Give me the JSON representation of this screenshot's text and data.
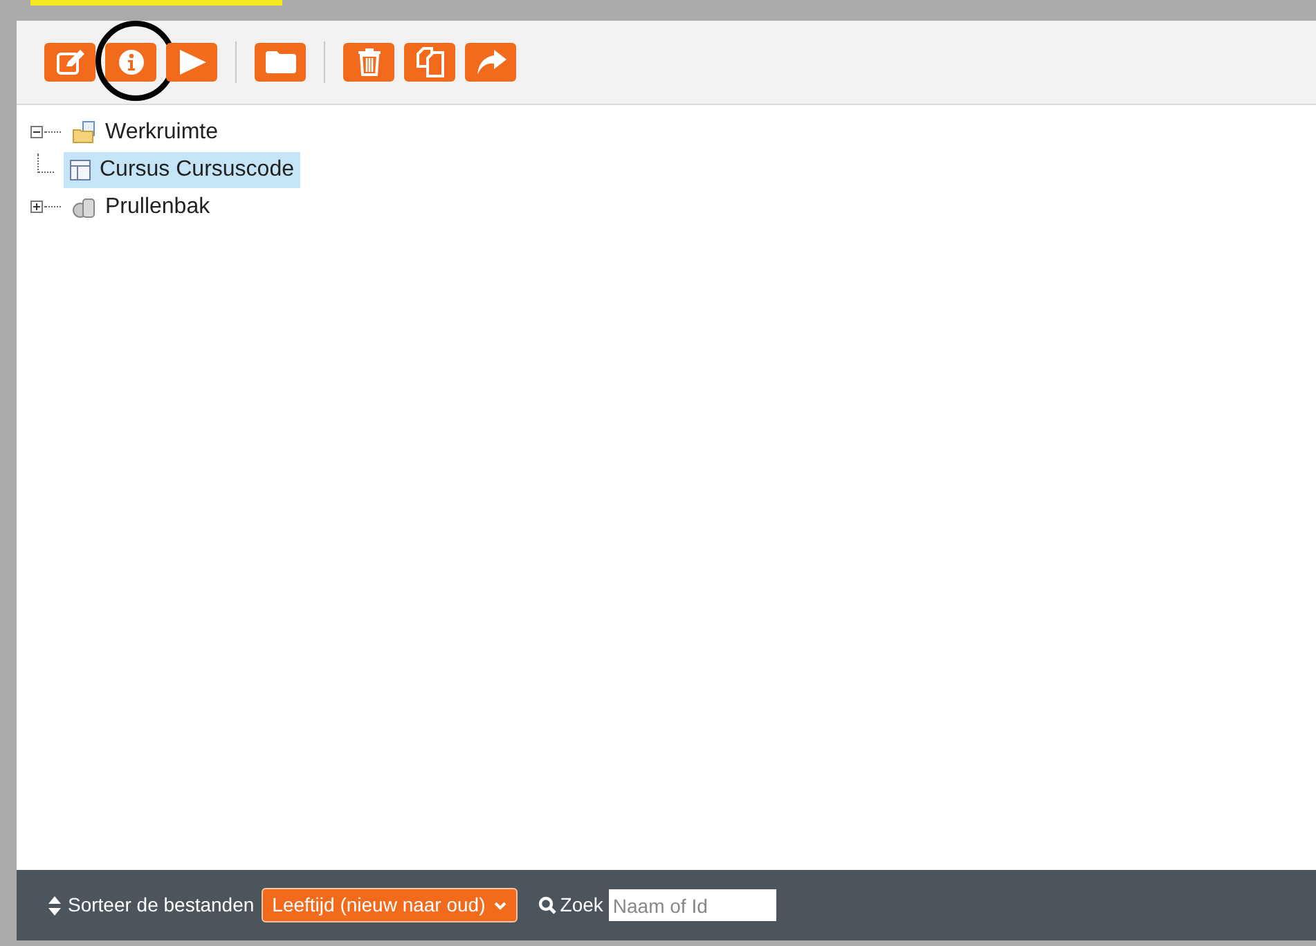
{
  "toolbar": {
    "groups": [
      [
        {
          "kind": "edit"
        },
        {
          "kind": "info",
          "circled": true
        },
        {
          "kind": "play"
        }
      ],
      [
        {
          "kind": "folder"
        }
      ],
      [
        {
          "kind": "trash"
        },
        {
          "kind": "copy"
        },
        {
          "kind": "share"
        }
      ]
    ]
  },
  "tree": [
    {
      "label": "Werkruimte",
      "kind": "workspace",
      "expanded": true,
      "selected": false,
      "children": [
        {
          "label": "Cursus Cursuscode",
          "kind": "course",
          "selected": true
        }
      ]
    },
    {
      "label": "Prullenbak",
      "kind": "trash",
      "expanded": false,
      "selected": false
    }
  ],
  "footer": {
    "sort_label": "Sorteer de bestanden",
    "sort_value": "Leeftijd (nieuw naar oud)",
    "search_label": "Zoek",
    "search_placeholder": "Naam of Id"
  }
}
